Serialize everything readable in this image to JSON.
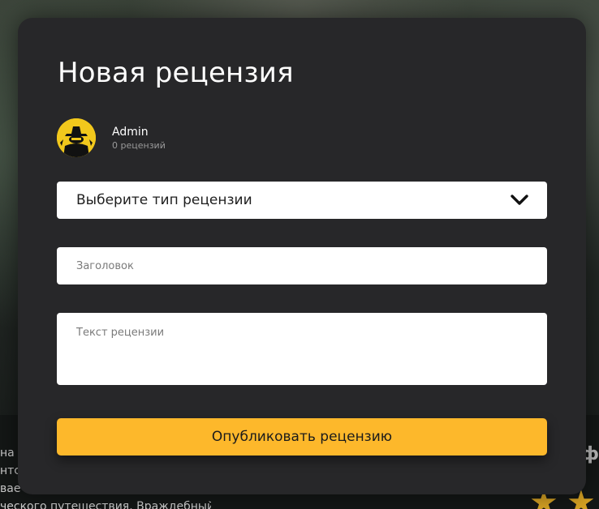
{
  "background": {
    "text_lines": [
      "на",
      "нтс",
      "вае",
      "ческого путешествия. Враждебный"
    ],
    "right_letter": "ф"
  },
  "modal": {
    "title": "Новая рецензия",
    "author": {
      "name": "Admin",
      "review_count": "0 рецензий",
      "avatar_icon": "avatar-image"
    },
    "type_select": {
      "selected_label": "Выберите тип рецензии",
      "icon": "chevron-down-icon"
    },
    "title_input": {
      "value": "",
      "placeholder": "Заголовок"
    },
    "text_input": {
      "value": "",
      "placeholder": "Текст рецензии"
    },
    "submit_label": "Опубликовать рецензию"
  },
  "colors": {
    "modal_bg": "#272729",
    "accent": "#fdb82b",
    "text_primary": "#ffffff",
    "text_secondary": "#9a9a9a"
  }
}
